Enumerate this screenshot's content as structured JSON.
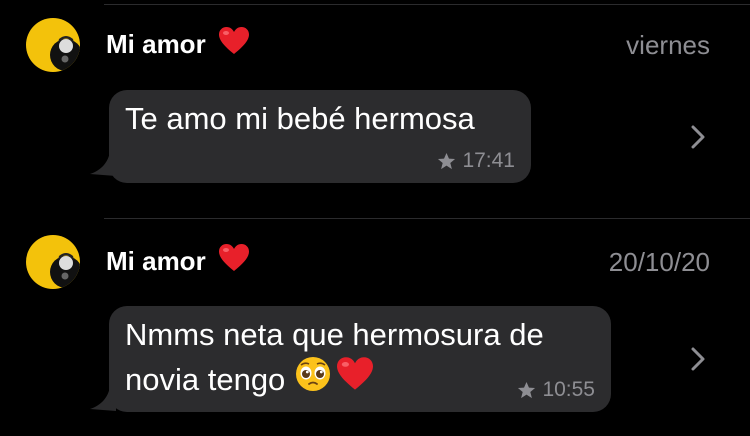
{
  "messages": [
    {
      "sender": "Mi amor",
      "date": "viernes",
      "text_lines": [
        "Te amo mi bebé hermosa"
      ],
      "time": "17:41",
      "starred": true,
      "emoji_after": [
        "heart"
      ]
    },
    {
      "sender": "Mi amor",
      "date": "20/10/20",
      "text_lines": [
        "Nmms neta que hermosura de",
        "novia tengo"
      ],
      "time": "10:55",
      "starred": true,
      "inline_emojis": [
        "pleading-face",
        "red-heart"
      ]
    }
  ],
  "colors": {
    "background": "#000000",
    "bubble": "#2c2c2e",
    "secondary_text": "#8e8e93",
    "avatar": "#f3c20b",
    "heart": "#e8202a"
  }
}
